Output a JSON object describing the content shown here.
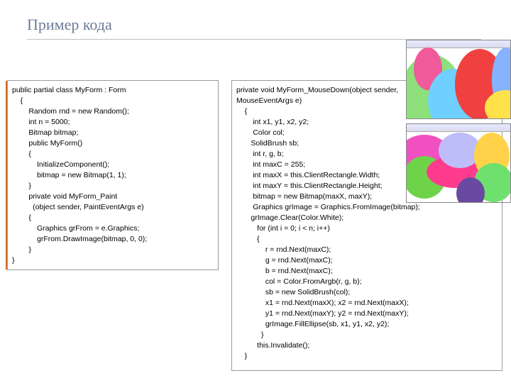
{
  "title": "Пример кода",
  "deco_caption": "",
  "code_left": "public partial class MyForm : Form\n    {\n        Random rnd = new Random();\n        int n = 5000;\n        Bitmap bitmap;\n        public MyForm()\n        {\n            InitializeComponent();\n            bitmap = new Bitmap(1, 1);\n        }\n        private void MyForm_Paint\n          (object sender, PaintEventArgs e)\n        {\n            Graphics grFrom = e.Graphics;\n            grFrom.DrawImage(bitmap, 0, 0);\n        }\n}",
  "code_right": "private void MyForm_MouseDown(object sender,\nMouseEventArgs e)\n    {\n        int x1, y1, x2, y2;\n        Color col;\n       SolidBrush sb;\n        int r, g, b;\n        int maxC = 255;\n        int maxX = this.ClientRectangle.Width;\n        int maxY = this.ClientRectangle.Height;\n        bitmap = new Bitmap(maxX, maxY);\n        Graphics grImage = Graphics.FromImage(bitmap);\n       grImage.Clear(Color.White);\n          for (int i = 0; i < n; i++)\n          {\n              r = rnd.Next(maxC);\n              g = rnd.Next(maxC);\n              b = rnd.Next(maxC);\n              col = Color.FromArgb(r, g, b);\n              sb = new SolidBrush(col);\n              x1 = rnd.Next(maxX); x2 = rnd.Next(maxX);\n              y1 = rnd.Next(maxY); y2 = rnd.Next(maxY);\n              grImage.FillEllipse(sb, x1, y1, x2, y2);\n            }\n          this.Invalidate();\n    }"
}
